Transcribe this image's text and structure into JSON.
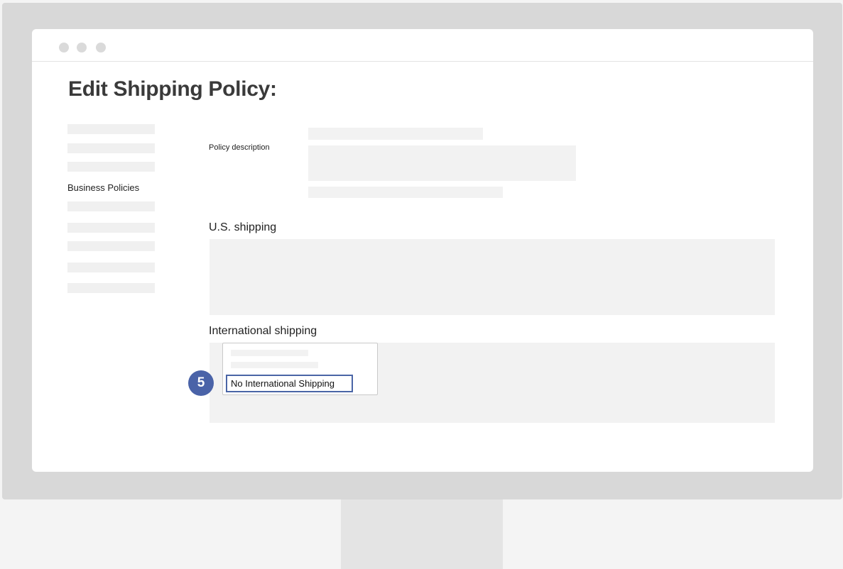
{
  "page": {
    "title": "Edit Shipping Policy:"
  },
  "sidebar": {
    "active_item_label": "Business Policies"
  },
  "form": {
    "policy_description_label": "Policy description",
    "us_shipping_label": "U.S. shipping",
    "international_shipping_label": "International shipping"
  },
  "dropdown": {
    "selected_option": "No International Shipping"
  },
  "annotation": {
    "step_number": "5"
  },
  "colors": {
    "accent": "#4a63a8",
    "skeleton": "#f2f2f2",
    "bezel": "#d8d8d8"
  }
}
